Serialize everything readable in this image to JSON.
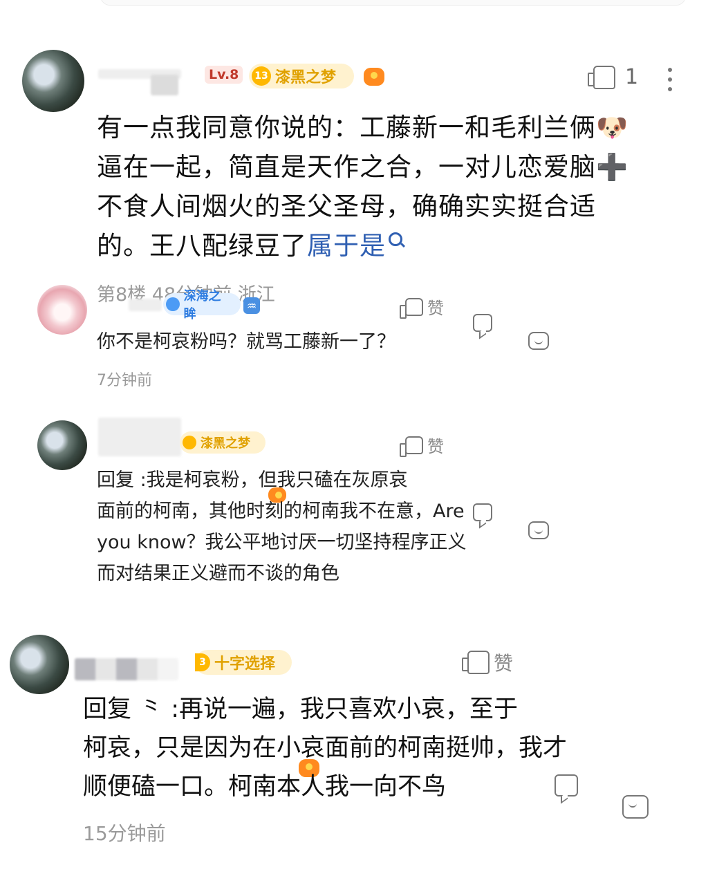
{
  "comment_main": {
    "level": "Lv.8",
    "fan_badge": {
      "num": "13",
      "name": "漆黑之梦"
    },
    "like_count": "1",
    "text_lines": [
      "有一点我同意你说的：工藤新一和毛利兰俩🐶",
      "逼在一起，简直是天作之合，一对儿恋爱脑➕",
      "不食人间烟火的圣父圣母，确确实实挺合适",
      "的。王八配绿豆了"
    ],
    "link_text": "属于是",
    "meta": "第8楼 48分钟前 浙江"
  },
  "reply1": {
    "fan_badge": {
      "name": "深海之眸"
    },
    "zodiac_icon": "♒",
    "text": "你不是柯哀粉吗？就骂工藤新一了？",
    "time": "7分钟前",
    "like_label": "赞"
  },
  "reply2": {
    "fan_badge": {
      "name": "漆黑之梦"
    },
    "text_lines": [
      "回复            :我是柯哀粉，但我只磕在灰原哀",
      "面前的柯南，其他时刻的柯南我不在意，Are",
      "you know？我公平地讨厌一切坚持程序正义",
      "而对结果正义避而不谈的角色"
    ],
    "like_label": "赞"
  },
  "reply3": {
    "fan_badge": {
      "num": "3",
      "name": "十字选择"
    },
    "text_lines": [
      "回复        ⺀ :再说一遍，我只喜欢小哀，至于",
      "柯哀，只是因为在小哀面前的柯南挺帅，我才",
      "顺便磕一口。柯南本人我一向不鸟"
    ],
    "time": "15分钟前",
    "like_label": "赞"
  }
}
